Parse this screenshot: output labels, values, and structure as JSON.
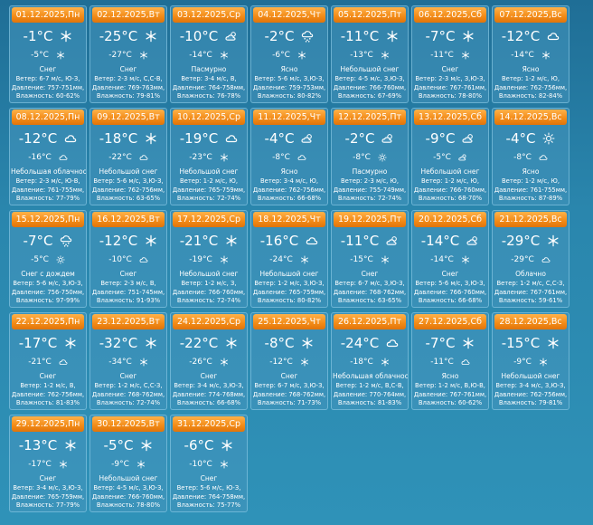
{
  "days": [
    {
      "date": "01.12.2025,Пн",
      "day_temp": "-1°C",
      "night_temp": "-5°C",
      "day_icon": "snowflake-icon",
      "night_icon": "snowflake-icon",
      "condition": "Снег",
      "wind": "Ветер: 6-7 м/с, Ю-З,",
      "pressure": "Давление: 757-751мм,",
      "humidity": "Влажность: 60-62%"
    },
    {
      "date": "02.12.2025,Вт",
      "day_temp": "-25°C",
      "night_temp": "-27°C",
      "day_icon": "snowflake-icon",
      "night_icon": "snowflake-icon",
      "condition": "Снег",
      "wind": "Ветер: 2-3 м/с, С,С-В,",
      "pressure": "Давление: 769-763мм,",
      "humidity": "Влажность: 79-81%"
    },
    {
      "date": "03.12.2025,Ср",
      "day_temp": "-10°C",
      "night_temp": "-14°C",
      "day_icon": "partly-cloudy-icon",
      "night_icon": "snowflake-icon",
      "condition": "Пасмурно",
      "wind": "Ветер: 3-4 м/с, В,",
      "pressure": "Давление: 764-758мм,",
      "humidity": "Влажность: 76-78%"
    },
    {
      "date": "04.12.2025,Чт",
      "day_temp": "-2°C",
      "night_temp": "-6°C",
      "day_icon": "cloud-snow-icon",
      "night_icon": "snowflake-icon",
      "condition": "Ясно",
      "wind": "Ветер: 5-6 м/с, З,Ю-З,",
      "pressure": "Давление: 759-753мм,",
      "humidity": "Влажность: 80-82%"
    },
    {
      "date": "05.12.2025,Пт",
      "day_temp": "-11°C",
      "night_temp": "-13°C",
      "day_icon": "snowflake-icon",
      "night_icon": "snowflake-icon",
      "condition": "Небольшой снег",
      "wind": "Ветер: 4-5 м/с, З,Ю-З,",
      "pressure": "Давление: 766-760мм,",
      "humidity": "Влажность: 67-69%"
    },
    {
      "date": "06.12.2025,Сб",
      "day_temp": "-7°C",
      "night_temp": "-11°C",
      "day_icon": "snowflake-icon",
      "night_icon": "snowflake-icon",
      "condition": "Снег",
      "wind": "Ветер: 2-3 м/с, З,Ю-З,",
      "pressure": "Давление: 767-761мм,",
      "humidity": "Влажность: 78-80%"
    },
    {
      "date": "07.12.2025,Вс",
      "day_temp": "-12°C",
      "night_temp": "-14°C",
      "day_icon": "cloud-icon",
      "night_icon": "snowflake-icon",
      "condition": "Ясно",
      "wind": "Ветер: 1-2 м/с, Ю,",
      "pressure": "Давление: 762-756мм,",
      "humidity": "Влажность: 82-84%"
    },
    {
      "date": "08.12.2025,Пн",
      "day_temp": "-12°C",
      "night_temp": "-16°C",
      "day_icon": "cloud-icon",
      "night_icon": "cloud-icon",
      "condition": "Небольшая облачность",
      "wind": "Ветер: 2-3 м/с, Ю-В,",
      "pressure": "Давление: 761-755мм,",
      "humidity": "Влажность: 77-79%"
    },
    {
      "date": "09.12.2025,Вт",
      "day_temp": "-18°C",
      "night_temp": "-22°C",
      "day_icon": "snowflake-icon",
      "night_icon": "cloud-icon",
      "condition": "Небольшой снег",
      "wind": "Ветер: 5-6 м/с, З,Ю-З,",
      "pressure": "Давление: 762-756мм,",
      "humidity": "Влажность: 63-65%"
    },
    {
      "date": "10.12.2025,Ср",
      "day_temp": "-19°C",
      "night_temp": "-23°C",
      "day_icon": "cloud-icon",
      "night_icon": "snowflake-icon",
      "condition": "Небольшой снег",
      "wind": "Ветер: 1-2 м/с, Ю,",
      "pressure": "Давление: 765-759мм,",
      "humidity": "Влажность: 72-74%"
    },
    {
      "date": "11.12.2025,Чт",
      "day_temp": "-4°C",
      "night_temp": "-8°C",
      "day_icon": "partly-cloudy-icon",
      "night_icon": "cloud-icon",
      "condition": "Ясно",
      "wind": "Ветер: 3-4 м/с, Ю,",
      "pressure": "Давление: 762-756мм,",
      "humidity": "Влажность: 66-68%"
    },
    {
      "date": "12.12.2025,Пт",
      "day_temp": "-2°C",
      "night_temp": "-8°C",
      "day_icon": "partly-cloudy-icon",
      "night_icon": "sun-icon",
      "condition": "Пасмурно",
      "wind": "Ветер: 2-3 м/с, Ю,",
      "pressure": "Давление: 755-749мм,",
      "humidity": "Влажность: 72-74%"
    },
    {
      "date": "13.12.2025,Сб",
      "day_temp": "-9°C",
      "night_temp": "-5°C",
      "day_icon": "partly-cloudy-icon",
      "night_icon": "partly-cloudy-icon",
      "condition": "Небольшой снег",
      "wind": "Ветер: 1-2 м/с, Ю,",
      "pressure": "Давление: 766-760мм,",
      "humidity": "Влажность: 68-70%"
    },
    {
      "date": "14.12.2025,Вс",
      "day_temp": "-4°C",
      "night_temp": "-8°C",
      "day_icon": "sun-icon",
      "night_icon": "cloud-icon",
      "condition": "Ясно",
      "wind": "Ветер: 1-2 м/с, Ю,",
      "pressure": "Давление: 761-755мм,",
      "humidity": "Влажность: 87-89%"
    },
    {
      "date": "15.12.2025,Пн",
      "day_temp": "-7°C",
      "night_temp": "-5°C",
      "day_icon": "cloud-snow-icon",
      "night_icon": "sun-icon",
      "condition": "Снег с дождем",
      "wind": "Ветер: 5-6 м/с, З,Ю-З,",
      "pressure": "Давление: 756-750мм,",
      "humidity": "Влажность: 97-99%"
    },
    {
      "date": "16.12.2025,Вт",
      "day_temp": "-12°C",
      "night_temp": "-10°C",
      "day_icon": "snowflake-icon",
      "night_icon": "cloud-icon",
      "condition": "Снег",
      "wind": "Ветер: 2-3 м/с, В,",
      "pressure": "Давление: 751-745мм,",
      "humidity": "Влажность: 91-93%"
    },
    {
      "date": "17.12.2025,Ср",
      "day_temp": "-21°C",
      "night_temp": "-19°C",
      "day_icon": "snowflake-icon",
      "night_icon": "snowflake-icon",
      "condition": "Небольшой снег",
      "wind": "Ветер: 1-2 м/с, З,",
      "pressure": "Давление: 766-760мм,",
      "humidity": "Влажность: 72-74%"
    },
    {
      "date": "18.12.2025,Чт",
      "day_temp": "-16°C",
      "night_temp": "-24°C",
      "day_icon": "cloud-icon",
      "night_icon": "snowflake-icon",
      "condition": "Небольшой снег",
      "wind": "Ветер: 1-2 м/с, З,Ю-З,",
      "pressure": "Давление: 765-759мм,",
      "humidity": "Влажность: 80-82%"
    },
    {
      "date": "19.12.2025,Пт",
      "day_temp": "-11°C",
      "night_temp": "-15°C",
      "day_icon": "partly-cloudy-icon",
      "night_icon": "snowflake-icon",
      "condition": "Снег",
      "wind": "Ветер: 6-7 м/с, З,Ю-З,",
      "pressure": "Давление: 768-762мм,",
      "humidity": "Влажность: 63-65%"
    },
    {
      "date": "20.12.2025,Сб",
      "day_temp": "-14°C",
      "night_temp": "-14°C",
      "day_icon": "partly-cloudy-icon",
      "night_icon": "snowflake-icon",
      "condition": "Снег",
      "wind": "Ветер: 5-6 м/с, З,Ю-З,",
      "pressure": "Давление: 766-760мм,",
      "humidity": "Влажность: 66-68%"
    },
    {
      "date": "21.12.2025,Вс",
      "day_temp": "-29°C",
      "night_temp": "-29°C",
      "day_icon": "snowflake-icon",
      "night_icon": "cloud-icon",
      "condition": "Облачно",
      "wind": "Ветер: 1-2 м/с, С,С-З,",
      "pressure": "Давление: 767-761мм,",
      "humidity": "Влажность: 59-61%"
    },
    {
      "date": "22.12.2025,Пн",
      "day_temp": "-17°C",
      "night_temp": "-21°C",
      "day_icon": "snowflake-icon",
      "night_icon": "cloud-icon",
      "condition": "Снег",
      "wind": "Ветер: 1-2 м/с, В,",
      "pressure": "Давление: 762-756мм,",
      "humidity": "Влажность: 81-83%"
    },
    {
      "date": "23.12.2025,Вт",
      "day_temp": "-32°C",
      "night_temp": "-34°C",
      "day_icon": "snowflake-icon",
      "night_icon": "snowflake-icon",
      "condition": "Снег",
      "wind": "Ветер: 1-2 м/с, С,С-З,",
      "pressure": "Давление: 768-762мм,",
      "humidity": "Влажность: 72-74%"
    },
    {
      "date": "24.12.2025,Ср",
      "day_temp": "-22°C",
      "night_temp": "-26°C",
      "day_icon": "snowflake-icon",
      "night_icon": "snowflake-icon",
      "condition": "Снег",
      "wind": "Ветер: 3-4 м/с, З,Ю-З,",
      "pressure": "Давление: 774-768мм,",
      "humidity": "Влажность: 66-68%"
    },
    {
      "date": "25.12.2025,Чт",
      "day_temp": "-8°C",
      "night_temp": "-12°C",
      "day_icon": "snowflake-icon",
      "night_icon": "snowflake-icon",
      "condition": "Снег",
      "wind": "Ветер: 6-7 м/с, З,Ю-З,",
      "pressure": "Давление: 768-762мм,",
      "humidity": "Влажность: 71-73%"
    },
    {
      "date": "26.12.2025,Пт",
      "day_temp": "-24°C",
      "night_temp": "-18°C",
      "day_icon": "cloud-icon",
      "night_icon": "snowflake-icon",
      "condition": "Небольшая облачность",
      "wind": "Ветер: 1-2 м/с, В,С-В,",
      "pressure": "Давление: 770-764мм,",
      "humidity": "Влажность: 81-83%"
    },
    {
      "date": "27.12.2025,Сб",
      "day_temp": "-7°C",
      "night_temp": "-11°C",
      "day_icon": "snowflake-icon",
      "night_icon": "cloud-icon",
      "condition": "Ясно",
      "wind": "Ветер: 1-2 м/с, В,Ю-В,",
      "pressure": "Давление: 767-761мм,",
      "humidity": "Влажность: 60-62%"
    },
    {
      "date": "28.12.2025,Вс",
      "day_temp": "-15°C",
      "night_temp": "-9°C",
      "day_icon": "snowflake-icon",
      "night_icon": "snowflake-icon",
      "condition": "Небольшой снег",
      "wind": "Ветер: 3-4 м/с, З,Ю-З,",
      "pressure": "Давление: 762-756мм,",
      "humidity": "Влажность: 79-81%"
    },
    {
      "date": "29.12.2025,Пн",
      "day_temp": "-13°C",
      "night_temp": "-17°C",
      "day_icon": "snowflake-icon",
      "night_icon": "snowflake-icon",
      "condition": "Снег",
      "wind": "Ветер: 3-4 м/с, З,Ю-З,",
      "pressure": "Давление: 765-759мм,",
      "humidity": "Влажность: 77-79%"
    },
    {
      "date": "30.12.2025,Вт",
      "day_temp": "-5°C",
      "night_temp": "-9°C",
      "day_icon": "snowflake-icon",
      "night_icon": "snowflake-icon",
      "condition": "Небольшой снег",
      "wind": "Ветер: 4-5 м/с, З,Ю-З,",
      "pressure": "Давление: 766-760мм,",
      "humidity": "Влажность: 78-80%"
    },
    {
      "date": "31.12.2025,Ср",
      "day_temp": "-6°C",
      "night_temp": "-10°C",
      "day_icon": "snowflake-icon",
      "night_icon": "snowflake-icon",
      "condition": "Снег",
      "wind": "Ветер: 5-6 м/с, Ю-З,",
      "pressure": "Давление: 764-758мм,",
      "humidity": "Влажность: 75-77%"
    }
  ]
}
